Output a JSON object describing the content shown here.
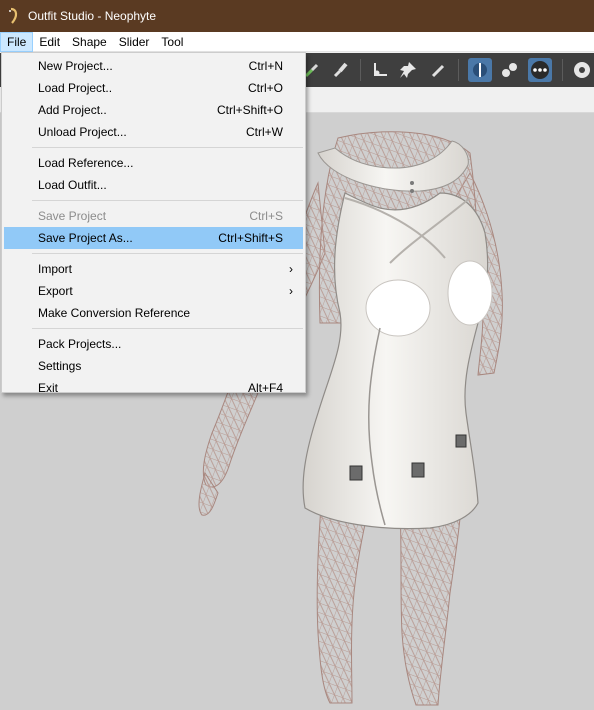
{
  "window": {
    "title": "Outfit Studio - Neophyte"
  },
  "menubar": {
    "items": [
      {
        "label": "File"
      },
      {
        "label": "Edit"
      },
      {
        "label": "Shape"
      },
      {
        "label": "Slider"
      },
      {
        "label": "Tool"
      }
    ]
  },
  "file_menu": {
    "new_project": {
      "label": "New Project...",
      "shortcut": "Ctrl+N"
    },
    "load_project": {
      "label": "Load Project..",
      "shortcut": "Ctrl+O"
    },
    "add_project": {
      "label": "Add Project..",
      "shortcut": "Ctrl+Shift+O"
    },
    "unload_project": {
      "label": "Unload Project...",
      "shortcut": "Ctrl+W"
    },
    "load_reference": {
      "label": "Load Reference..."
    },
    "load_outfit": {
      "label": "Load Outfit..."
    },
    "save_project": {
      "label": "Save Project",
      "shortcut": "Ctrl+S"
    },
    "save_project_as": {
      "label": "Save Project As...",
      "shortcut": "Ctrl+Shift+S"
    },
    "import": {
      "label": "Import",
      "arrow": "›"
    },
    "export": {
      "label": "Export",
      "arrow": "›"
    },
    "make_conversion_reference": {
      "label": "Make Conversion Reference"
    },
    "pack_projects": {
      "label": "Pack Projects..."
    },
    "settings": {
      "label": "Settings"
    },
    "exit": {
      "label": "Exit",
      "shortcut": "Alt+F4"
    }
  },
  "colors": {
    "titlebar": "#5a3a22",
    "highlight": "#91c9f7",
    "toolbar": "#3f3f3f",
    "toolbar_selected": "#4a78a8",
    "viewport": "#cfcfcf",
    "mesh_wire": "#b89a92",
    "dress": "#f4f2ee"
  },
  "toolbar_icons": [
    "brush-color-icon",
    "brush-icon",
    "transform-icon",
    "pin-icon",
    "pencil-icon",
    "pivot-icon",
    "weight-points-icon",
    "vertex-dots-icon",
    "circle-icon"
  ]
}
